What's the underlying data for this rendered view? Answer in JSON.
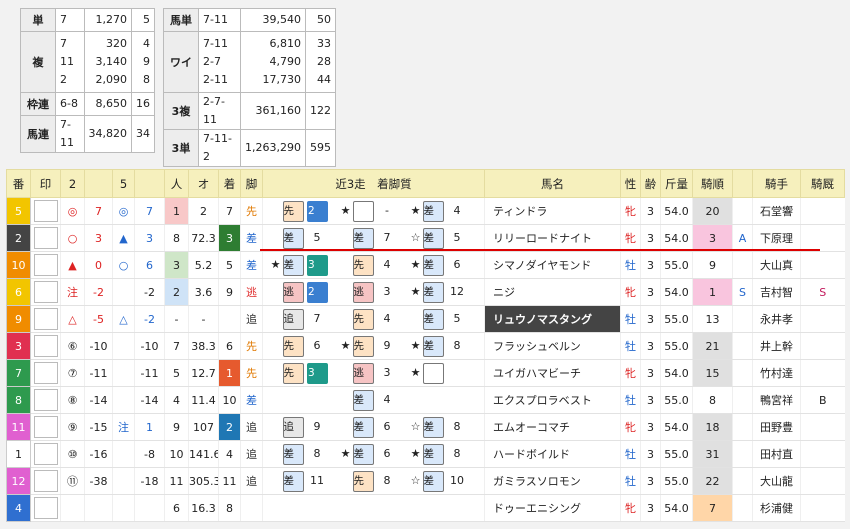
{
  "payout_left": {
    "tan": {
      "label": "単",
      "rows": [
        {
          "combo": "7",
          "amount": "1,270",
          "pop": "5"
        }
      ]
    },
    "fuku": {
      "label": "複",
      "rows": [
        {
          "combo": "7",
          "amount": "320",
          "pop": "4"
        },
        {
          "combo": "11",
          "amount": "3,140",
          "pop": "9"
        },
        {
          "combo": "2",
          "amount": "2,090",
          "pop": "8"
        }
      ]
    },
    "wakuren": {
      "label": "枠連",
      "rows": [
        {
          "combo": "6-8",
          "amount": "8,650",
          "pop": "16"
        }
      ]
    },
    "umaren": {
      "label": "馬連",
      "rows": [
        {
          "combo": "7-11",
          "amount": "34,820",
          "pop": "34"
        }
      ]
    }
  },
  "payout_right": {
    "umatan": {
      "label": "馬単",
      "rows": [
        {
          "combo": "7-11",
          "amount": "39,540",
          "pop": "50"
        }
      ]
    },
    "wide": {
      "label": "ワイ",
      "rows": [
        {
          "combo": "7-11",
          "amount": "6,810",
          "pop": "33"
        },
        {
          "combo": "2-7",
          "amount": "4,790",
          "pop": "28"
        },
        {
          "combo": "2-11",
          "amount": "17,730",
          "pop": "44"
        }
      ]
    },
    "sanpuku": {
      "label": "3複",
      "rows": [
        {
          "combo": "2-7-11",
          "amount": "361,160",
          "pop": "122"
        }
      ]
    },
    "santan": {
      "label": "3単",
      "rows": [
        {
          "combo": "7-11-2",
          "amount": "1,263,290",
          "pop": "595"
        }
      ]
    }
  },
  "headers": [
    "番",
    "印",
    "2",
    "",
    "5",
    "",
    "人",
    "オ",
    "着",
    "脚",
    "近3走　着脚質",
    "馬名",
    "性",
    "齢",
    "斤量",
    "騎順",
    "",
    "騎手",
    "騎厩"
  ],
  "rows": [
    {
      "num": "5",
      "numColor": "#f2c500",
      "m2": "◎",
      "m2c": "red",
      "v2": "7",
      "v2c": "red",
      "m5": "◎",
      "m5c": "blue",
      "v5": "7",
      "v5c": "blue",
      "nin": "1",
      "ninCls": "ninkip",
      "odds": "2",
      "chaku": "7",
      "chakuCls": "",
      "kyaku": "先",
      "kyakuC": "#e07800",
      "r1s": "",
      "r1": "先",
      "r1c": "sen",
      "r1n": "2",
      "r1nc": "b",
      "r2s": "★",
      "r2": "",
      "r2c": "e",
      "r2n": "-",
      "r3s": "★",
      "r3": "差",
      "r3c": "sa",
      "r3n": "4",
      "name": "ティンドラ",
      "dark": false,
      "sex": "牝",
      "sexC": "red",
      "age": "3",
      "kin": "54.0",
      "kijun": "20",
      "kijunCls": "kb",
      "ab": "",
      "jockey": "石堂響",
      "kyu": ""
    },
    {
      "num": "2",
      "numColor": "#444444",
      "m2": "○",
      "m2c": "red",
      "v2": "3",
      "v2c": "red",
      "m5": "▲",
      "m5c": "blue",
      "v5": "3",
      "v5c": "blue",
      "nin": "8",
      "ninCls": "",
      "odds": "72.3",
      "chaku": "3",
      "chakuCls": "tgreen",
      "kyaku": "差",
      "kyakuC": "#2266cc",
      "r1s": "",
      "r1": "差",
      "r1c": "sa",
      "r1n": "5",
      "r1nc": "",
      "r2s": "",
      "r2": "差",
      "r2c": "sa",
      "r2n": "7",
      "r3s": "☆",
      "r3": "差",
      "r3c": "sa",
      "r3n": "5",
      "name": "リリーロードナイト",
      "dark": false,
      "sex": "牝",
      "sexC": "red",
      "age": "3",
      "kin": "54.0",
      "kijun": "3",
      "kijunCls": "kp",
      "ab": "A",
      "jockey": "下原理",
      "kyu": ""
    },
    {
      "num": "10",
      "numColor": "#f08c00",
      "m2": "▲",
      "m2c": "red",
      "v2": "0",
      "v2c": "red",
      "m5": "○",
      "m5c": "blue",
      "v5": "6",
      "v5c": "blue",
      "nin": "3",
      "ninCls": "ninkig",
      "odds": "5.2",
      "chaku": "5",
      "chakuCls": "",
      "kyaku": "差",
      "kyakuC": "#2266cc",
      "r1s": "★",
      "r1": "差",
      "r1c": "sa",
      "r1n": "3",
      "r1nc": "g",
      "r2s": "",
      "r2": "先",
      "r2c": "sen",
      "r2n": "4",
      "r3s": "★",
      "r3": "差",
      "r3c": "sa",
      "r3n": "6",
      "name": "シマノダイヤモンド",
      "dark": false,
      "sex": "牡",
      "sexC": "blue",
      "age": "3",
      "kin": "55.0",
      "kijun": "9",
      "kijunCls": "",
      "ab": "",
      "jockey": "大山真",
      "kyu": ""
    },
    {
      "num": "6",
      "numColor": "#f2c500",
      "m2": "注",
      "m2c": "red",
      "v2": "-2",
      "v2c": "red",
      "m5": "",
      "m5c": "blue",
      "v5": "-2",
      "v5c": "",
      "nin": "2",
      "ninCls": "ninkib",
      "odds": "3.6",
      "chaku": "9",
      "chakuCls": "",
      "kyaku": "逃",
      "kyakuC": "#e03030",
      "r1s": "",
      "r1": "逃",
      "r1c": "nige",
      "r1n": "2",
      "r1nc": "b",
      "r2s": "",
      "r2": "逃",
      "r2c": "nige",
      "r2n": "3",
      "r3s": "★",
      "r3": "差",
      "r3c": "sa",
      "r3n": "12",
      "name": "ニジ",
      "dark": false,
      "sex": "牝",
      "sexC": "red",
      "age": "3",
      "kin": "54.0",
      "kijun": "1",
      "kijunCls": "kp",
      "ab": "S",
      "jockey": "吉村智",
      "kyu": "S"
    },
    {
      "num": "9",
      "numColor": "#f08c00",
      "m2": "△",
      "m2c": "red",
      "v2": "-5",
      "v2c": "red",
      "m5": "△",
      "m5c": "blue",
      "v5": "-2",
      "v5c": "blue",
      "nin": "-",
      "ninCls": "",
      "odds": "-",
      "chaku": "",
      "chakuCls": "",
      "kyaku": "追",
      "kyakuC": "#333",
      "r1s": "",
      "r1": "追",
      "r1c": "oi",
      "r1n": "7",
      "r1nc": "",
      "r2s": "",
      "r2": "先",
      "r2c": "sen",
      "r2n": "4",
      "r3s": "",
      "r3": "差",
      "r3c": "sa",
      "r3n": "5",
      "name": "リュウノマスタング",
      "dark": true,
      "sex": "牡",
      "sexC": "blue",
      "age": "3",
      "kin": "55.0",
      "kijun": "13",
      "kijunCls": "",
      "ab": "",
      "jockey": "永井孝",
      "kyu": ""
    },
    {
      "num": "3",
      "numColor": "#e03050",
      "m2": "⑥",
      "m2c": "",
      "v2": "-10",
      "v2c": "",
      "m5": "",
      "m5c": "",
      "v5": "-10",
      "v5c": "",
      "nin": "7",
      "ninCls": "",
      "odds": "38.3",
      "chaku": "6",
      "chakuCls": "",
      "kyaku": "先",
      "kyakuC": "#e07800",
      "r1s": "",
      "r1": "先",
      "r1c": "sen",
      "r1n": "6",
      "r1nc": "",
      "r2s": "★",
      "r2": "先",
      "r2c": "sen",
      "r2n": "9",
      "r3s": "★",
      "r3": "差",
      "r3c": "sa",
      "r3n": "8",
      "name": "フラッシュベルン",
      "dark": false,
      "sex": "牡",
      "sexC": "blue",
      "age": "3",
      "kin": "55.0",
      "kijun": "21",
      "kijunCls": "kb",
      "ab": "",
      "jockey": "井上幹",
      "kyu": ""
    },
    {
      "num": "7",
      "numColor": "#2e9a4e",
      "m2": "⑦",
      "m2c": "",
      "v2": "-11",
      "v2c": "",
      "m5": "",
      "m5c": "",
      "v5": "-11",
      "v5c": "",
      "nin": "5",
      "ninCls": "",
      "odds": "12.7",
      "chaku": "1",
      "chakuCls": "tred",
      "kyaku": "先",
      "kyakuC": "#e07800",
      "r1s": "",
      "r1": "先",
      "r1c": "sen",
      "r1n": "3",
      "r1nc": "g",
      "r2s": "",
      "r2": "逃",
      "r2c": "nige",
      "r2n": "3",
      "r3s": "★",
      "r3": "",
      "r3c": "e",
      "r3n": "",
      "name": "ユイガハマビーチ",
      "dark": false,
      "sex": "牝",
      "sexC": "red",
      "age": "3",
      "kin": "54.0",
      "kijun": "15",
      "kijunCls": "kb",
      "ab": "",
      "jockey": "竹村達",
      "kyu": ""
    },
    {
      "num": "8",
      "numColor": "#2e9a4e",
      "m2": "⑧",
      "m2c": "",
      "v2": "-14",
      "v2c": "",
      "m5": "",
      "m5c": "",
      "v5": "-14",
      "v5c": "",
      "nin": "4",
      "ninCls": "",
      "odds": "11.4",
      "chaku": "10",
      "chakuCls": "",
      "kyaku": "差",
      "kyakuC": "#2266cc",
      "r1s": "",
      "r1": "",
      "r1c": "",
      "r1n": "",
      "r1nc": "",
      "r2s": "",
      "r2": "差",
      "r2c": "sa",
      "r2n": "4",
      "r3s": "",
      "r3": "",
      "r3c": "",
      "r3n": "",
      "name": "エクスプロラベスト",
      "dark": false,
      "sex": "牡",
      "sexC": "blue",
      "age": "3",
      "kin": "55.0",
      "kijun": "8",
      "kijunCls": "",
      "ab": "",
      "jockey": "鴨宮祥",
      "kyu": "B"
    },
    {
      "num": "11",
      "numColor": "#e060d0",
      "m2": "⑨",
      "m2c": "",
      "v2": "-15",
      "v2c": "",
      "m5": "注",
      "m5c": "blue",
      "v5": "1",
      "v5c": "blue",
      "nin": "9",
      "ninCls": "",
      "odds": "107",
      "chaku": "2",
      "chakuCls": "tblue",
      "kyaku": "追",
      "kyakuC": "#333",
      "r1s": "",
      "r1": "追",
      "r1c": "oi",
      "r1n": "9",
      "r1nc": "",
      "r2s": "",
      "r2": "差",
      "r2c": "sa",
      "r2n": "6",
      "r3s": "☆",
      "r3": "差",
      "r3c": "sa",
      "r3n": "8",
      "name": "エムオーコマチ",
      "dark": false,
      "sex": "牝",
      "sexC": "red",
      "age": "3",
      "kin": "54.0",
      "kijun": "18",
      "kijunCls": "kb",
      "ab": "",
      "jockey": "田野豊",
      "kyu": ""
    },
    {
      "num": "1",
      "numColor": "#ffffff",
      "m2": "⑩",
      "m2c": "",
      "v2": "-16",
      "v2c": "",
      "m5": "",
      "m5c": "",
      "v5": "-8",
      "v5c": "",
      "nin": "10",
      "ninCls": "",
      "odds": "141.6",
      "chaku": "4",
      "chakuCls": "",
      "kyaku": "追",
      "kyakuC": "#333",
      "r1s": "",
      "r1": "差",
      "r1c": "sa",
      "r1n": "8",
      "r1nc": "",
      "r2s": "★",
      "r2": "差",
      "r2c": "sa",
      "r2n": "6",
      "r3s": "★",
      "r3": "差",
      "r3c": "sa",
      "r3n": "8",
      "name": "ハードボイルド",
      "dark": false,
      "sex": "牡",
      "sexC": "blue",
      "age": "3",
      "kin": "55.0",
      "kijun": "31",
      "kijunCls": "kb",
      "ab": "",
      "jockey": "田村直",
      "kyu": ""
    },
    {
      "num": "12",
      "numColor": "#e060d0",
      "m2": "⑪",
      "m2c": "",
      "v2": "-38",
      "v2c": "",
      "m5": "",
      "m5c": "",
      "v5": "-18",
      "v5c": "",
      "nin": "11",
      "ninCls": "",
      "odds": "305.3",
      "chaku": "11",
      "chakuCls": "",
      "kyaku": "追",
      "kyakuC": "#333",
      "r1s": "",
      "r1": "差",
      "r1c": "sa",
      "r1n": "11",
      "r1nc": "",
      "r2s": "",
      "r2": "先",
      "r2c": "sen",
      "r2n": "8",
      "r3s": "☆",
      "r3": "差",
      "r3c": "sa",
      "r3n": "10",
      "name": "ガミラスソロモン",
      "dark": false,
      "sex": "牡",
      "sexC": "blue",
      "age": "3",
      "kin": "55.0",
      "kijun": "22",
      "kijunCls": "kb",
      "ab": "",
      "jockey": "大山龍",
      "kyu": ""
    },
    {
      "num": "4",
      "numColor": "#2f6fd0",
      "m2": "",
      "m2c": "",
      "v2": "",
      "v2c": "",
      "m5": "",
      "m5c": "",
      "v5": "",
      "v5c": "",
      "nin": "6",
      "ninCls": "",
      "odds": "16.3",
      "chaku": "8",
      "chakuCls": "",
      "kyaku": "",
      "kyakuC": "#333",
      "r1s": "",
      "r1": "",
      "r1c": "",
      "r1n": "",
      "r1nc": "",
      "r2s": "",
      "r2": "",
      "r2c": "",
      "r2n": "",
      "r3s": "",
      "r3": "",
      "r3c": "",
      "r3n": "",
      "name": "ドゥーエニシング",
      "dark": false,
      "sex": "牝",
      "sexC": "red",
      "age": "3",
      "kin": "54.0",
      "kijun": "7",
      "kijunCls": "kpo",
      "ab": "",
      "jockey": "杉浦健",
      "kyu": ""
    }
  ]
}
